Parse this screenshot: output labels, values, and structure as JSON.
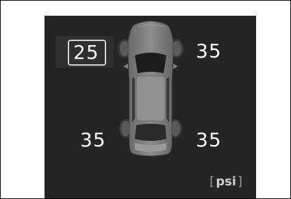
{
  "tires": {
    "front_left": {
      "value": "25",
      "status": "low"
    },
    "front_right": {
      "value": "35",
      "status": "normal"
    },
    "rear_left": {
      "value": "35",
      "status": "normal"
    },
    "rear_right": {
      "value": "35",
      "status": "normal"
    }
  },
  "unit": {
    "open": "[",
    "label": "psi",
    "close": "]"
  },
  "colors": {
    "screen_background": "#252525",
    "value_text": "#ffffff",
    "alert_outline": "#d6d6d6",
    "unit_text": "#9a9a9a"
  }
}
